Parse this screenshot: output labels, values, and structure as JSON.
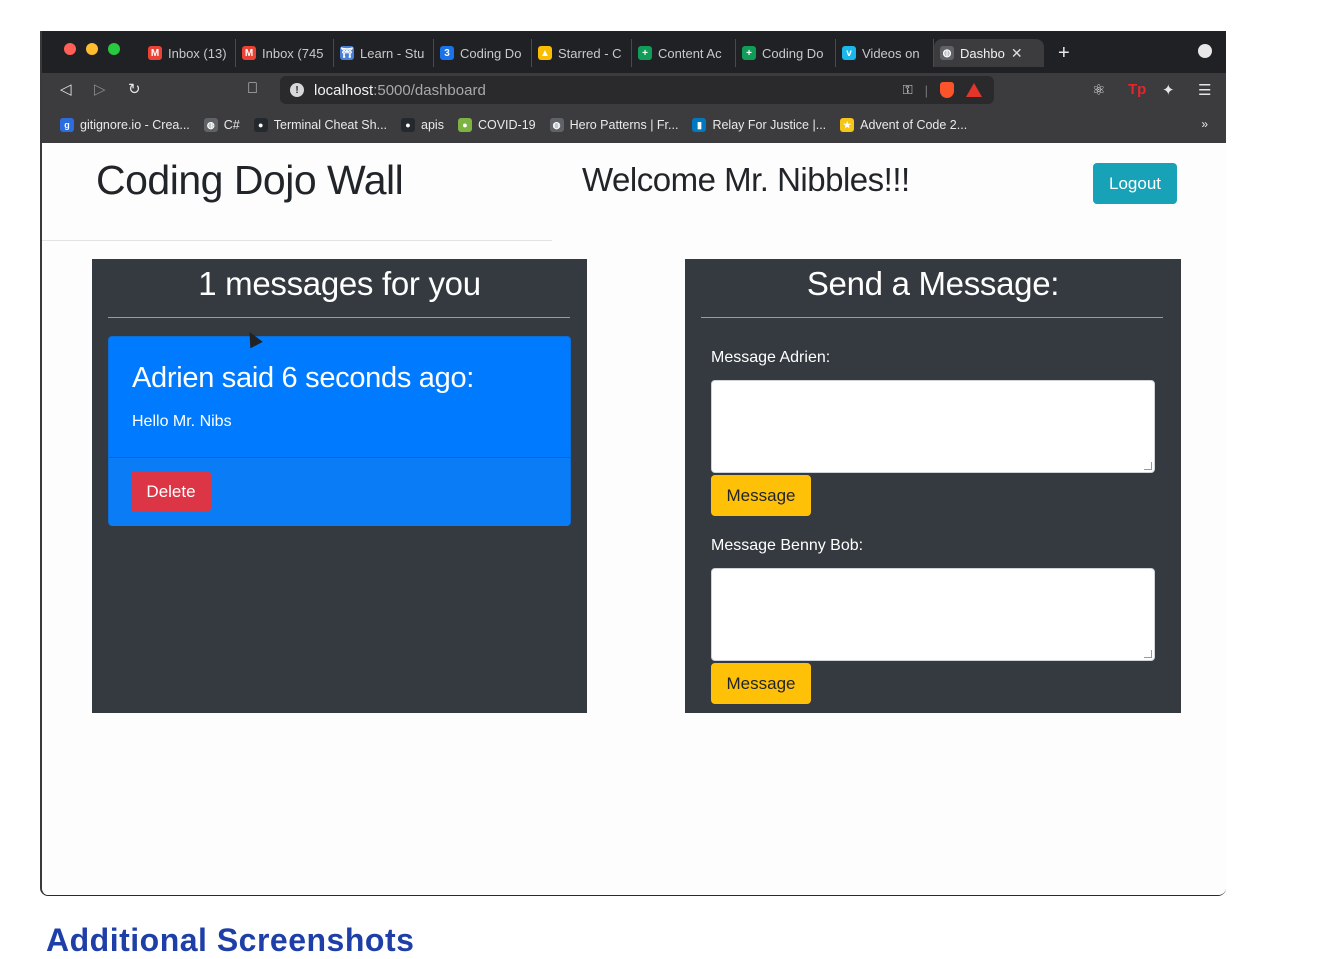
{
  "browser": {
    "tabs": [
      {
        "label": "Inbox (13)",
        "icon": "gmail-icon",
        "color": "#ea4335",
        "glyph": "M"
      },
      {
        "label": "Inbox (745",
        "icon": "gmail-icon",
        "color": "#ea4335",
        "glyph": "M"
      },
      {
        "label": "Learn - Stu",
        "icon": "torii-icon",
        "color": "#4a7fd6",
        "glyph": "⛩"
      },
      {
        "label": "Coding Do",
        "icon": "calendar-icon",
        "color": "#1a73e8",
        "glyph": "3"
      },
      {
        "label": "Starred - C",
        "icon": "drive-icon",
        "color": "#fbbc04",
        "glyph": "▲"
      },
      {
        "label": "Content Ac",
        "icon": "sheets-icon",
        "color": "#0f9d58",
        "glyph": "+"
      },
      {
        "label": "Coding Do",
        "icon": "sheets-icon",
        "color": "#0f9d58",
        "glyph": "+"
      },
      {
        "label": "Videos on",
        "icon": "vimeo-icon",
        "color": "#1ab7ea",
        "glyph": "v"
      },
      {
        "label": "Dashbo",
        "icon": "globe-icon",
        "color": "#5f6368",
        "glyph": "◍"
      }
    ],
    "url_host": "localhost",
    "url_path": ":5000/dashboard",
    "bookmarks": [
      {
        "label": "gitignore.io - Crea...",
        "icon": "gitignore-icon",
        "color": "#2d6cdf",
        "glyph": "g"
      },
      {
        "label": "C#",
        "icon": "globe-icon",
        "color": "#5f6368",
        "glyph": "◍"
      },
      {
        "label": "Terminal Cheat Sh...",
        "icon": "github-icon",
        "color": "#24292e",
        "glyph": "●"
      },
      {
        "label": "apis",
        "icon": "github-icon",
        "color": "#24292e",
        "glyph": "●"
      },
      {
        "label": "COVID-19",
        "icon": "covid-icon",
        "color": "#7cb342",
        "glyph": "●"
      },
      {
        "label": "Hero Patterns | Fr...",
        "icon": "globe-icon",
        "color": "#5f6368",
        "glyph": "◍"
      },
      {
        "label": "Relay For Justice |...",
        "icon": "trello-icon",
        "color": "#0079bf",
        "glyph": "▮"
      },
      {
        "label": "Advent of Code 2...",
        "icon": "star-icon",
        "color": "#f5c518",
        "glyph": "★"
      }
    ],
    "more_label": "»"
  },
  "page": {
    "brand": "Coding Dojo Wall",
    "welcome": "Welcome Mr. Nibbles!!!",
    "logout_label": "Logout",
    "messages": {
      "heading": "1 messages for you",
      "items": [
        {
          "title": "Adrien said 6 seconds ago:",
          "body": "Hello Mr. Nibs",
          "delete_label": "Delete"
        }
      ]
    },
    "send": {
      "heading": "Send a Message:",
      "forms": [
        {
          "label": "Message Adrien:",
          "button_label": "Message",
          "value": ""
        },
        {
          "label": "Message Benny Bob:",
          "button_label": "Message",
          "value": ""
        }
      ]
    }
  },
  "caption": "Additional Screenshots"
}
